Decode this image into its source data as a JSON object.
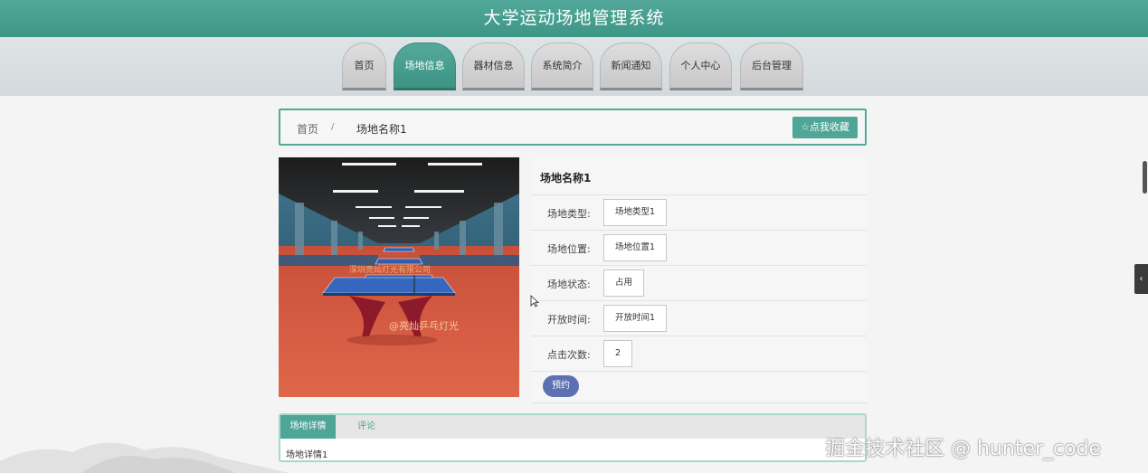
{
  "app": {
    "title": "大学运动场地管理系统"
  },
  "nav": {
    "items": [
      {
        "label": "首页",
        "active": false
      },
      {
        "label": "场地信息",
        "active": true
      },
      {
        "label": "器材信息",
        "active": false
      },
      {
        "label": "系统简介",
        "active": false
      },
      {
        "label": "新闻通知",
        "active": false
      },
      {
        "label": "个人中心",
        "active": false
      },
      {
        "label": "后台管理",
        "active": false
      }
    ]
  },
  "breadcrumb": {
    "home": "首页",
    "separator": "/",
    "current": "场地名称1"
  },
  "favorite_button": "☆点我收藏",
  "venue": {
    "name": "场地名称1",
    "fields": [
      {
        "label": "场地类型:",
        "value": "场地类型1"
      },
      {
        "label": "场地位置:",
        "value": "场地位置1"
      },
      {
        "label": "场地状态:",
        "value": "占用"
      },
      {
        "label": "开放时间:",
        "value": "开放时间1"
      },
      {
        "label": "点击次数:",
        "value": "2"
      }
    ],
    "book_button": "预约",
    "photo_texts": [
      "深圳亮灿灯光有限公司",
      "@亮灿乒乓灯光"
    ]
  },
  "detail_tabs": {
    "tabs": [
      "场地详情",
      "评论"
    ],
    "active_index": 0,
    "content": "场地详情1"
  },
  "watermark": "掘金技术社区 @ hunter_code",
  "colors": {
    "primary": "#4fa596",
    "book_button": "#5b71b1"
  }
}
